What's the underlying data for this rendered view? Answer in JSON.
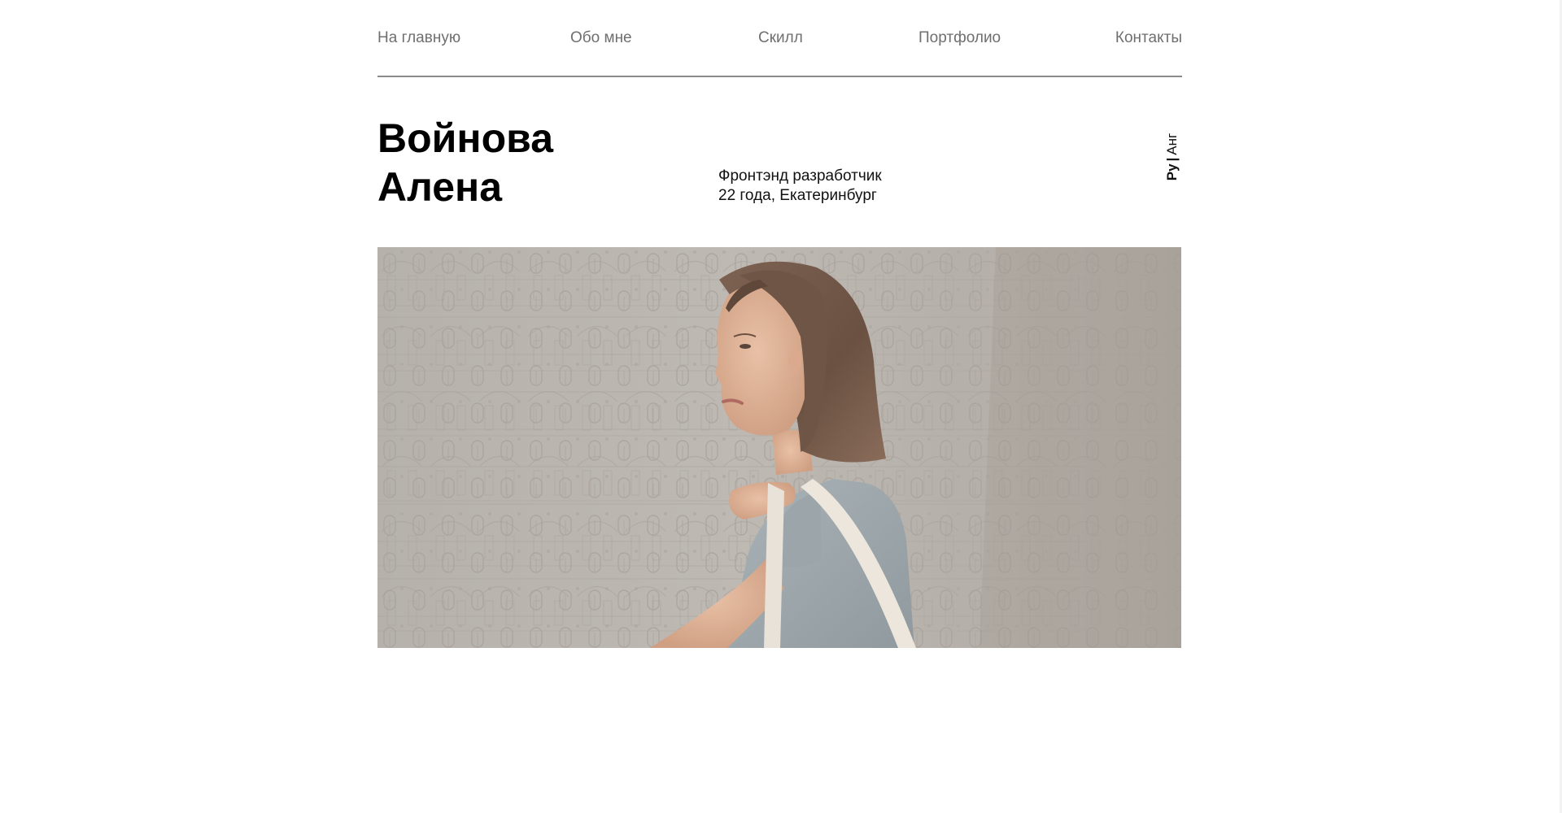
{
  "nav": {
    "items": [
      {
        "label": "На главную"
      },
      {
        "label": "Обо мне"
      },
      {
        "label": "Скилл"
      },
      {
        "label": "Портфолио"
      },
      {
        "label": "Контакты"
      }
    ]
  },
  "hero": {
    "name_line1": "Войнова",
    "name_line2": "Алена",
    "role": "Фронтэнд разработчик",
    "details": "22 года, Екатеринбург"
  },
  "language": {
    "ru": "Ру",
    "separator": "|",
    "en": "Анг"
  },
  "colors": {
    "nav_text": "#6f6f6f",
    "divider": "#8a8a8a",
    "heading": "#000000",
    "photo_background": "#b9b4ae"
  },
  "photo": {
    "icon": "portrait-photo"
  }
}
